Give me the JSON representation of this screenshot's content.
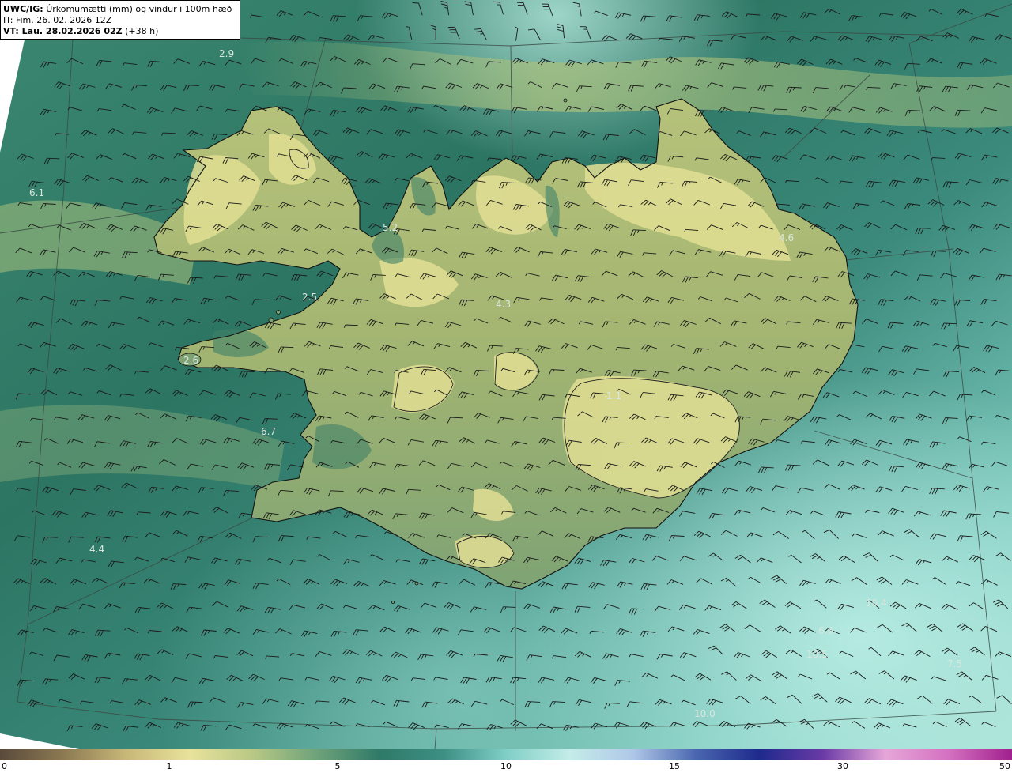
{
  "header": {
    "product": "UWC/IG:",
    "description": "Úrkomumætti (mm) og vindur i 100m hæð",
    "init_time": "IT: Fim. 26. 02. 2026 12Z",
    "valid_prefix": "VT: Lau. 28.02.2026 02Z",
    "valid_suffix": "(+38 h)"
  },
  "map_labels": [
    "2.9",
    "6.1",
    "5.2",
    "2.6",
    "2.5",
    "4.3",
    "6.7",
    "4.4",
    "1.1",
    "6.6",
    "10.5",
    "7.5",
    "10.0",
    "10.4",
    "4.6"
  ],
  "colorbar": {
    "ticks": [
      "0",
      "1",
      "5",
      "10",
      "15",
      "30",
      "50"
    ],
    "colors": [
      "#5a4a3c",
      "#8c7a52",
      "#c8b878",
      "#e8e29c",
      "#b8c884",
      "#6ea27a",
      "#2f7a68",
      "#3d8f84",
      "#7fcfc6",
      "#c4ece8",
      "#b0c8e8",
      "#4a66b0",
      "#1e2a8c",
      "#6a3aa6",
      "#e6a6d8",
      "#d470c0",
      "#a0208e"
    ]
  },
  "colors": {
    "ocean_deep": "#2a6f62",
    "ocean_mid": "#4c9584",
    "ocean_light": "#a9e0d6",
    "land_high": "#e2e08e",
    "land_mid": "#a8b870",
    "land_low": "#3f7f66",
    "coast": "#111111",
    "barb": "#1a1a1a"
  }
}
